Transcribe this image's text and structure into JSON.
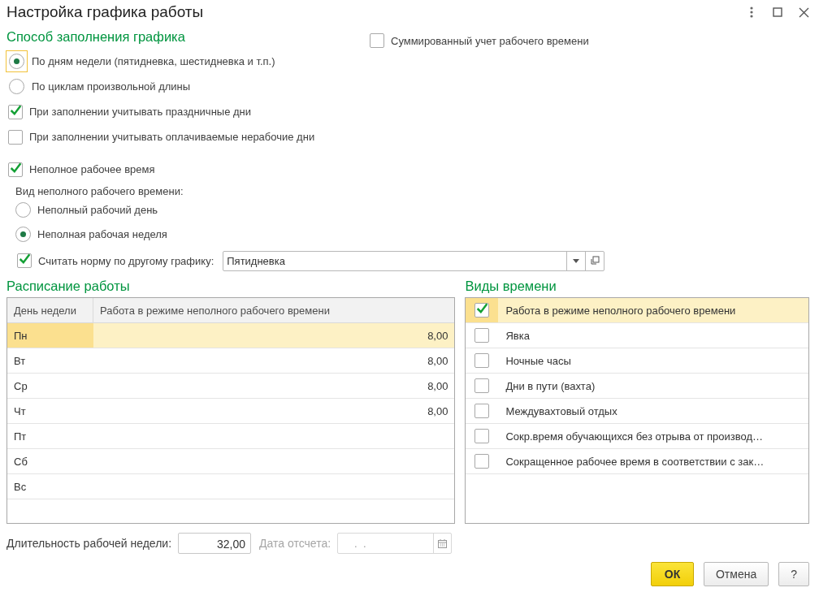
{
  "window": {
    "title": "Настройка графика работы"
  },
  "fill_method": {
    "title": "Способ заполнения графика",
    "options": [
      {
        "label": "По дням недели (пятидневка, шестидневка и т.п.)",
        "selected": true,
        "focused": true
      },
      {
        "label": "По циклам произвольной длины",
        "selected": false,
        "focused": false
      }
    ]
  },
  "summarized": {
    "label": "Суммированный учет рабочего времени",
    "checked": false
  },
  "fill_options": [
    {
      "label": "При заполнении учитывать праздничные дни",
      "checked": true
    },
    {
      "label": "При заполнении учитывать оплачиваемые нерабочие дни",
      "checked": false
    }
  ],
  "part_time": {
    "label": "Неполное рабочее время",
    "checked": true,
    "type_label": "Вид неполного рабочего времени:",
    "types": [
      {
        "label": "Неполный рабочий день",
        "selected": false
      },
      {
        "label": "Неполная рабочая неделя",
        "selected": true
      }
    ],
    "other_schedule": {
      "label": "Считать норму по другому графику:",
      "checked": true,
      "value": "Пятидневка"
    }
  },
  "schedule": {
    "title": "Расписание работы",
    "columns": [
      "День недели",
      "Работа в режиме неполного рабочего времени"
    ],
    "rows": [
      {
        "day": "Пн",
        "hours": "8,00",
        "selected": true
      },
      {
        "day": "Вт",
        "hours": "8,00",
        "selected": false
      },
      {
        "day": "Ср",
        "hours": "8,00",
        "selected": false
      },
      {
        "day": "Чт",
        "hours": "8,00",
        "selected": false
      },
      {
        "day": "Пт",
        "selected": false
      },
      {
        "day": "Сб",
        "selected": false
      },
      {
        "day": "Вс",
        "selected": false
      }
    ]
  },
  "time_kinds": {
    "title": "Виды времени",
    "items": [
      {
        "label": "Работа в режиме неполного рабочего времени",
        "checked": true,
        "selected": true
      },
      {
        "label": "Явка",
        "checked": false,
        "selected": false
      },
      {
        "label": "Ночные часы",
        "checked": false,
        "selected": false
      },
      {
        "label": "Дни в пути (вахта)",
        "checked": false,
        "selected": false
      },
      {
        "label": "Междувахтовый отдых",
        "checked": false,
        "selected": false
      },
      {
        "label": "Сокр.время обучающихся без отрыва от производ…",
        "checked": false,
        "selected": false
      },
      {
        "label": "Сокращенное рабочее время в соответствии с зак…",
        "checked": false,
        "selected": false
      }
    ]
  },
  "week_duration": {
    "label": "Длительность рабочей недели:",
    "value": "32,00"
  },
  "start_date": {
    "label": "Дата отсчета:",
    "placeholder": ".  .",
    "disabled": true
  },
  "buttons": [
    {
      "label": "ОК",
      "kind": "default"
    },
    {
      "label": "Отмена",
      "kind": "normal"
    },
    {
      "label": "?",
      "kind": "normal"
    }
  ]
}
